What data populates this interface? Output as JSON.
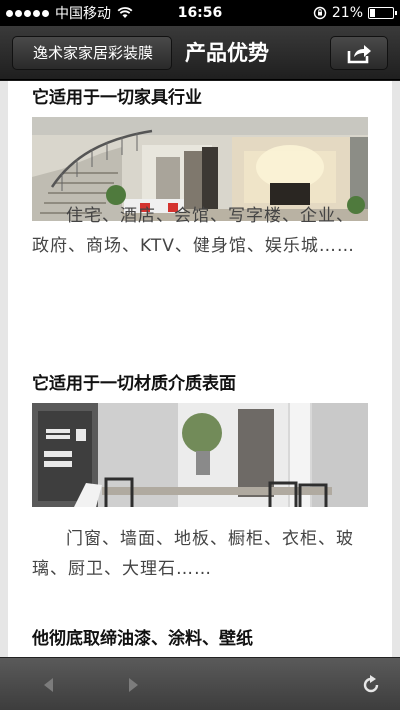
{
  "status": {
    "carrier": "中国移动",
    "time": "16:56",
    "battery": "21%",
    "battery_level": 0.21
  },
  "nav": {
    "back_label": "逸术家家居彩装膜",
    "title": "产品优势",
    "share_icon": "share-icon"
  },
  "sections": [
    {
      "title": "它适用于一切家具行业",
      "text": "住宅、酒店、会馆、写字楼、企业、政府、商场、KTV、健身馆、娱乐城……"
    },
    {
      "title": "它适用于一切材质介质表面",
      "text": "门窗、墙面、地板、橱柜、衣柜、玻璃、厨卫、大理石……"
    },
    {
      "title": "他彻底取缔油漆、涂料、壁纸",
      "text": ""
    }
  ],
  "toolbar": {
    "back_icon": "arrow-left-icon",
    "forward_icon": "arrow-right-icon",
    "refresh_icon": "refresh-icon"
  }
}
